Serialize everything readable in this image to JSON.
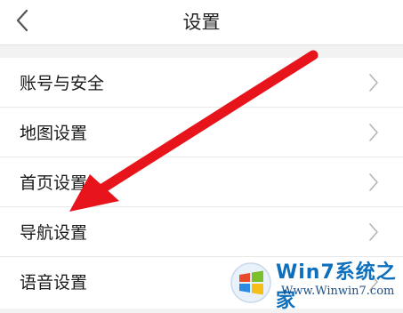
{
  "header": {
    "title": "设置",
    "back_icon": "chevron-left-icon"
  },
  "settings": {
    "items": [
      {
        "label": "账号与安全",
        "icon": "chevron-right-icon"
      },
      {
        "label": "地图设置",
        "icon": "chevron-right-icon"
      },
      {
        "label": "首页设置",
        "icon": "chevron-right-icon"
      },
      {
        "label": "导航设置",
        "icon": "chevron-right-icon"
      },
      {
        "label": "语音设置",
        "icon": "chevron-right-icon"
      }
    ]
  },
  "annotation": {
    "arrow_color": "#e8141b",
    "points_to": "导航设置"
  },
  "watermark": {
    "brand": "Win7系统之家",
    "url": "Www.Winwin7.com",
    "logo": "windows-logo-icon"
  },
  "colors": {
    "background": "#f2f2f2",
    "surface": "#ffffff",
    "text": "#1a1a1a",
    "chevron": "#b5b5b5"
  }
}
